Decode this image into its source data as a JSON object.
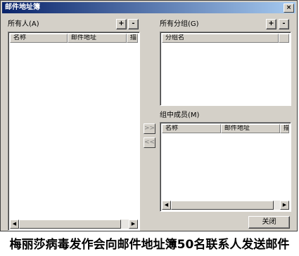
{
  "window": {
    "title": "邮件地址簿",
    "close_glyph": "×"
  },
  "all_people": {
    "label": "所有人(A)",
    "add_label": "+",
    "remove_label": "-",
    "columns": [
      "名称",
      "邮件地址",
      "描"
    ]
  },
  "all_groups": {
    "label": "所有分组(G)",
    "add_label": "+",
    "remove_label": "-",
    "columns": [
      "分组名"
    ]
  },
  "group_members": {
    "label": "组中成员(M)",
    "columns": [
      "名称",
      "邮件地址",
      "描"
    ]
  },
  "move_buttons": {
    "add_to_group": ">>",
    "remove_from_group": "<<"
  },
  "close_button": "关闭",
  "scroll_arrows": {
    "left": "◀",
    "right": "▶"
  },
  "caption": "梅丽莎病毒发作会向邮件地址簿50名联系人发送邮件"
}
